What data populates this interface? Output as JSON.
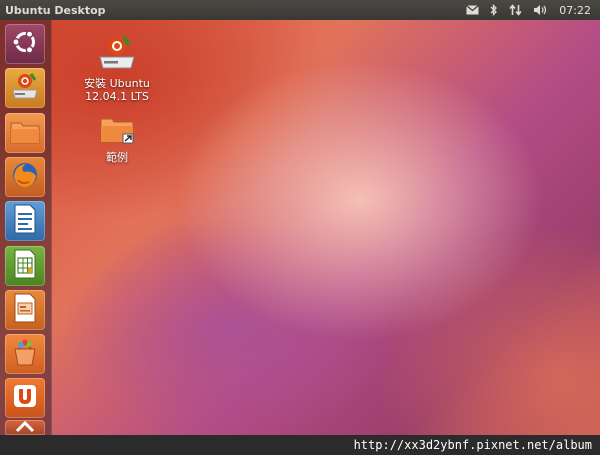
{
  "panel": {
    "title": "Ubuntu Desktop",
    "clock": "07:22",
    "indicators": [
      "mail-icon",
      "bluetooth-icon",
      "network-icon",
      "volume-icon"
    ]
  },
  "launcher": {
    "items": [
      {
        "name": "dash-home",
        "icon": "ubuntu-logo-icon"
      },
      {
        "name": "install-ubuntu",
        "icon": "installer-icon"
      },
      {
        "name": "home-folder",
        "icon": "folder-icon"
      },
      {
        "name": "firefox",
        "icon": "firefox-icon"
      },
      {
        "name": "libreoffice-writer",
        "icon": "writer-icon"
      },
      {
        "name": "libreoffice-calc",
        "icon": "calc-icon"
      },
      {
        "name": "libreoffice-impress",
        "icon": "impress-icon"
      },
      {
        "name": "ubuntu-software-center",
        "icon": "software-center-icon"
      },
      {
        "name": "ubuntu-one",
        "icon": "ubuntu-one-icon"
      }
    ]
  },
  "desktop_icons": {
    "install": {
      "label_line1": "安裝 Ubuntu",
      "label_line2": "12.04.1 LTS"
    },
    "examples": {
      "label": "範例"
    }
  },
  "watermark": "http://xx3d2ybnf.pixnet.net/album",
  "colors": {
    "panel": "#3c3b37",
    "launcher_accent": "#e95420",
    "wallpaper_main": "#d4472d"
  }
}
